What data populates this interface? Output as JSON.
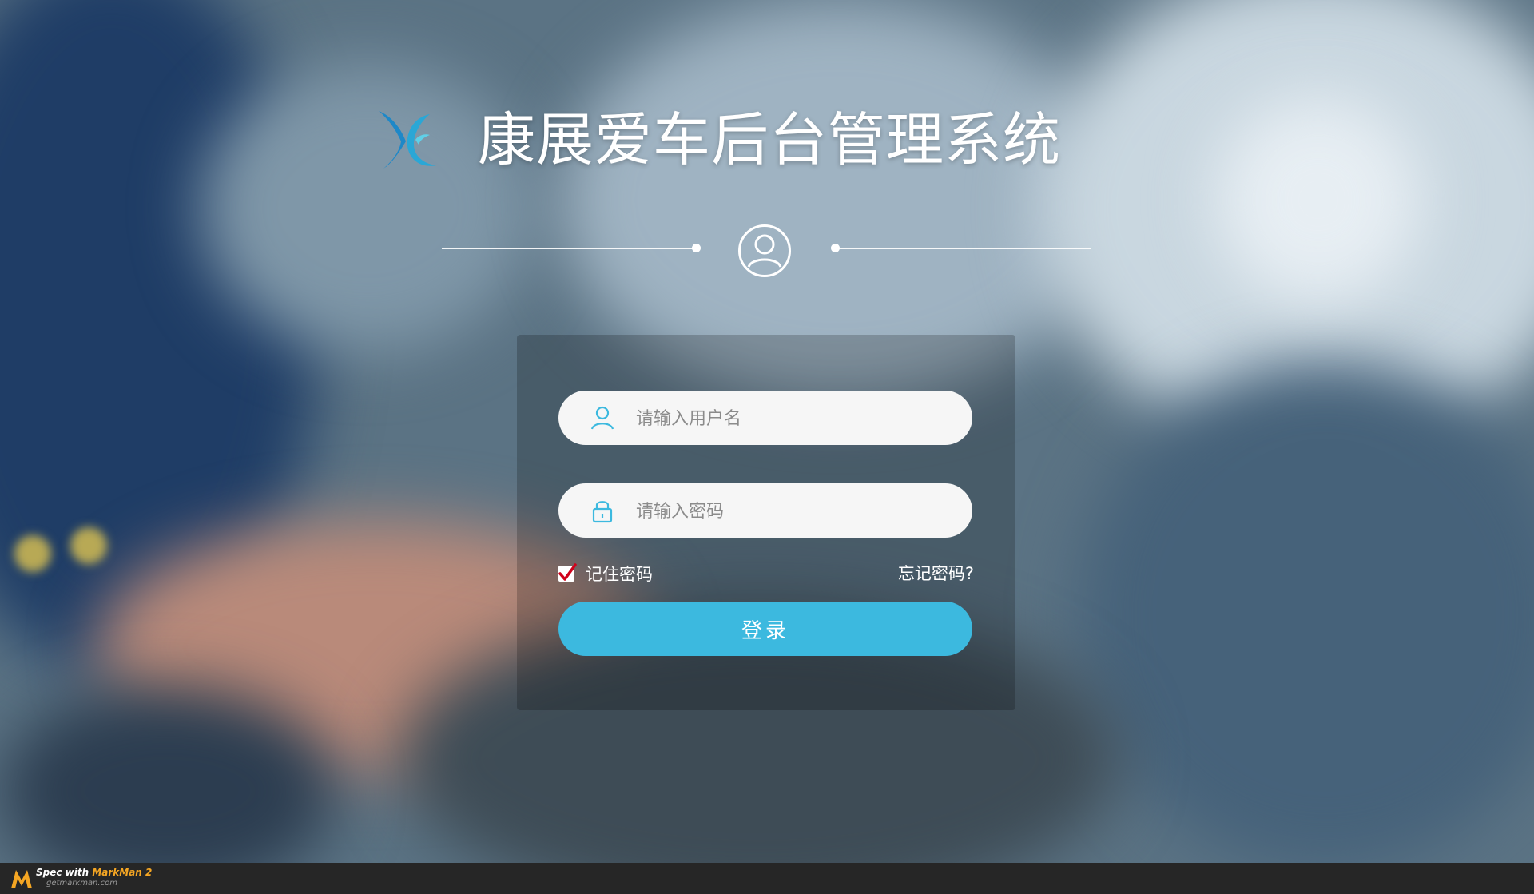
{
  "app": {
    "title": "康展爱车后台管理系统",
    "logo_icon": "kz-logo-icon",
    "avatar_icon": "user-avatar-icon"
  },
  "login": {
    "username_placeholder": "请输入用户名",
    "username_icon": "user-icon",
    "password_placeholder": "请输入密码",
    "password_icon": "lock-icon",
    "remember_label": "记住密码",
    "remember_checked": true,
    "forgot_label": "忘记密码?",
    "login_button": "登录"
  },
  "colors": {
    "accent": "#3cb9df",
    "placeholder": "#8b8b8b",
    "panel_overlay": "rgba(0,0,0,0.2)",
    "check": "#d0021b"
  },
  "footer": {
    "spec_prefix": "Spec with",
    "brand": "MarkMan 2",
    "url": "getmarkman.com"
  }
}
